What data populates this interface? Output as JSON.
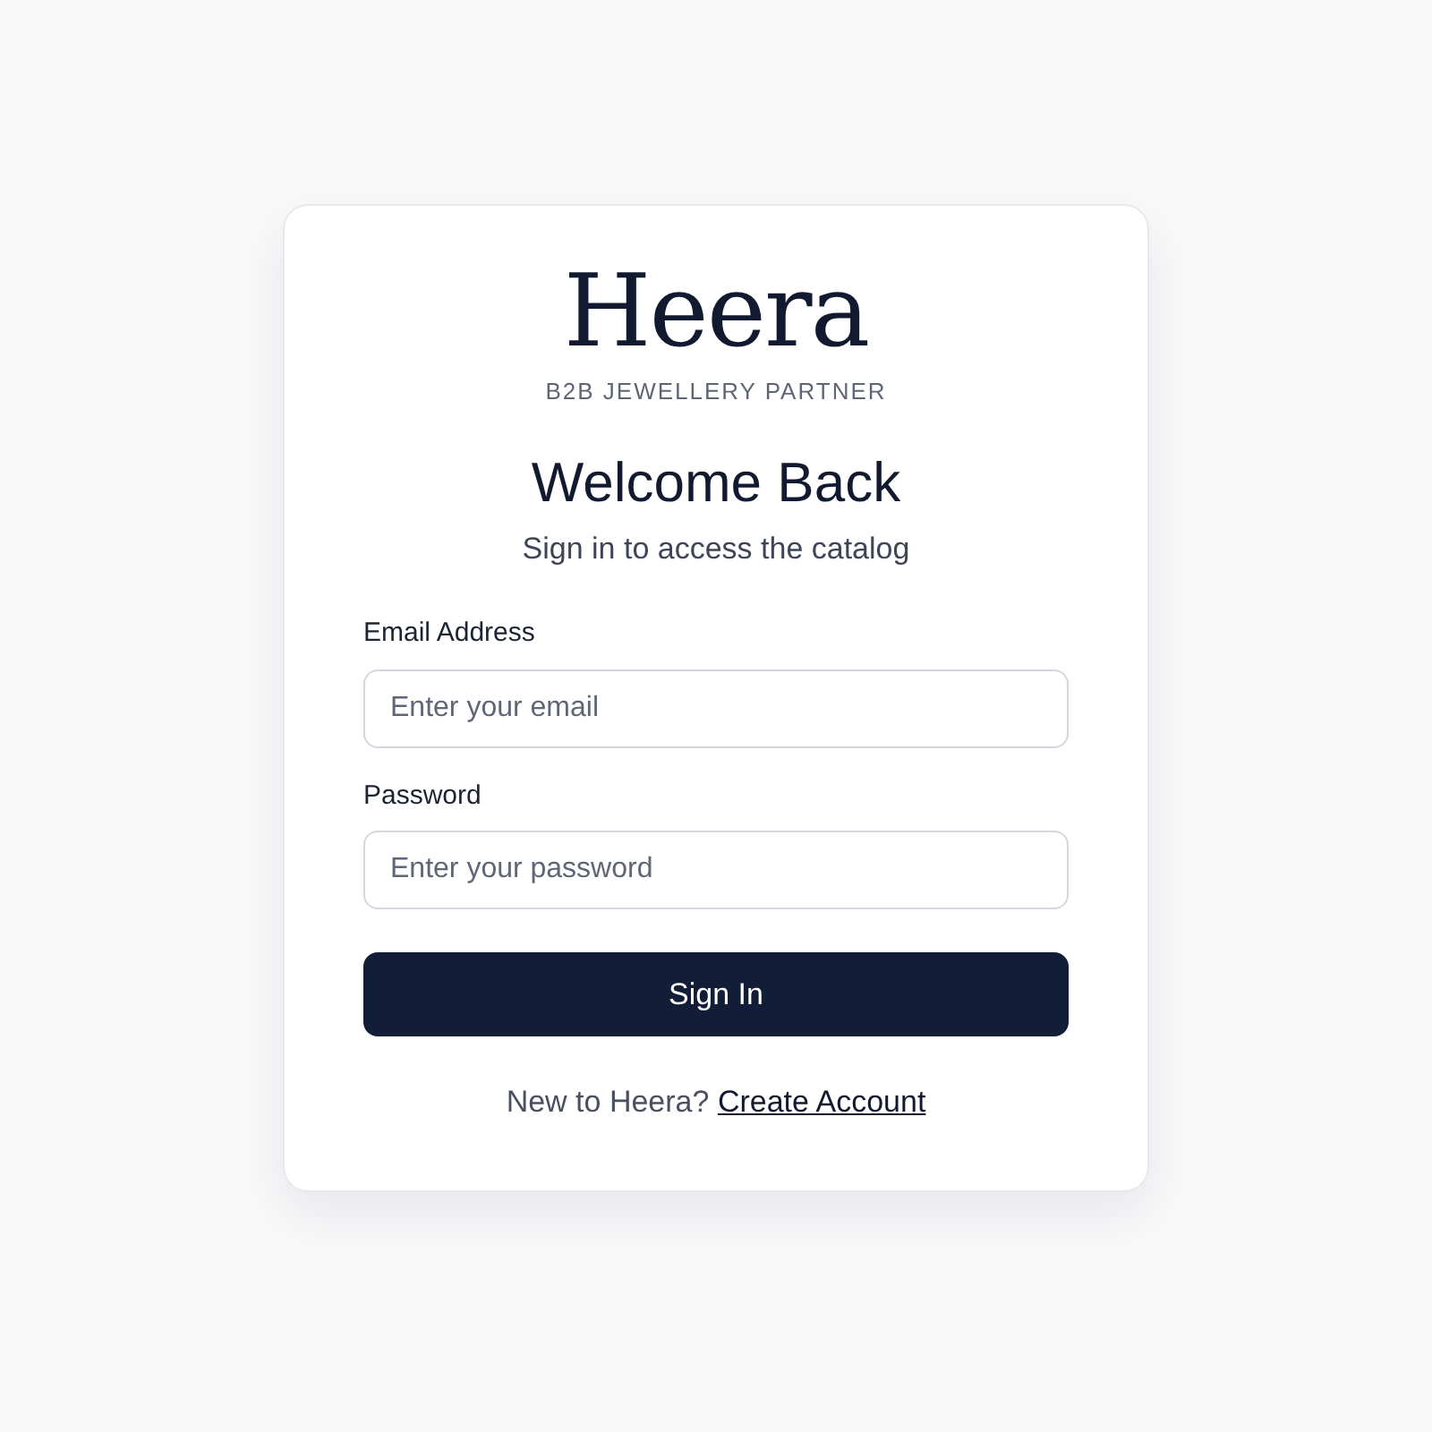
{
  "brand": {
    "name": "Heera",
    "tagline": "B2B JEWELLERY PARTNER"
  },
  "heading": "Welcome Back",
  "subheading": "Sign in to access the catalog",
  "fields": [
    {
      "label": "Email Address",
      "placeholder": "Enter your email"
    },
    {
      "label": "Password",
      "placeholder": "Enter your password"
    }
  ],
  "submit": "Sign In",
  "footer": {
    "text": "New to Heera?",
    "link": "Create Account"
  }
}
